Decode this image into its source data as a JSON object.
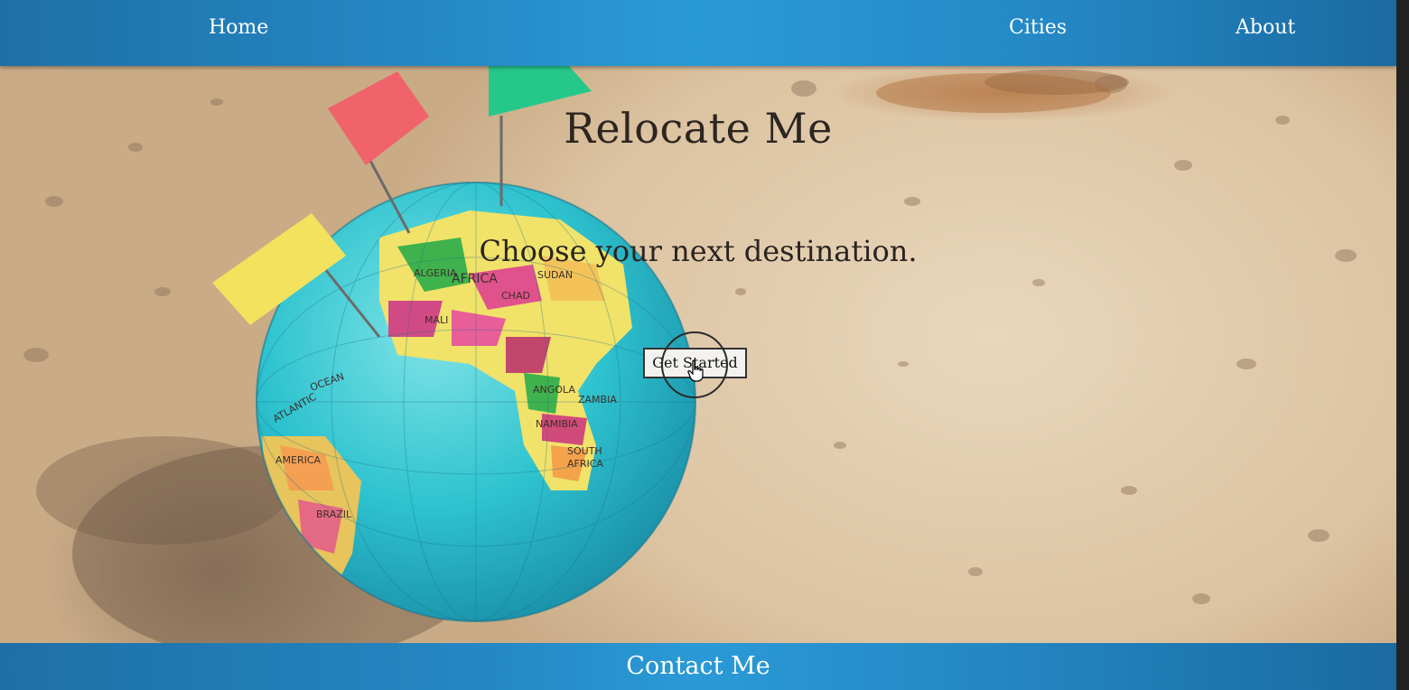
{
  "nav": {
    "home": "Home",
    "cities": "Cities",
    "about": "About"
  },
  "hero": {
    "title": "Relocate Me",
    "subtitle": "Choose your next destination.",
    "cta_label": "Get Started",
    "globe_labels": [
      "ALGERIA",
      "AFRICA",
      "CHAD",
      "SUDAN",
      "MALI",
      "OCEAN",
      "ATLANTIC",
      "SOUTH AFRICA",
      "ANGOLA",
      "ZAMBIA",
      "NAMIBIA",
      "BRAZIL",
      "AMERICA"
    ]
  },
  "footer": {
    "contact": "Contact Me"
  },
  "colors": {
    "nav_blue": "#2488c4",
    "sand": "#e2cdb0",
    "ocean": "#2ec3cf"
  },
  "icons": [
    "hand-pointer-icon",
    "red-flag-icon",
    "green-flag-icon",
    "yellow-flag-icon",
    "globe-icon"
  ]
}
